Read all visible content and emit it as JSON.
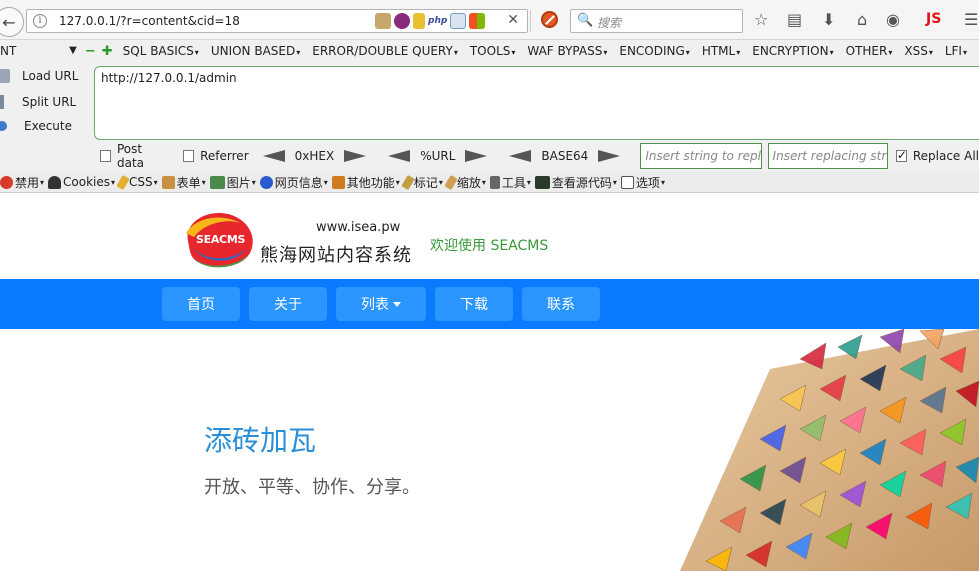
{
  "browser": {
    "url": "127.0.0.1/?r=content&cid=18",
    "search_placeholder": "搜索",
    "js_badge": "JS"
  },
  "hackbar": {
    "select_value": "NT",
    "menu": [
      "SQL BASICS",
      "UNION BASED",
      "ERROR/DOUBLE QUERY",
      "TOOLS",
      "WAF BYPASS",
      "ENCODING",
      "HTML",
      "ENCRYPTION",
      "OTHER",
      "XSS",
      "LFI"
    ],
    "load_url": "Load URL",
    "split_url": "Split URL",
    "execute": "Execute",
    "url_value": "http://127.0.0.1/admin",
    "post_data": "Post data",
    "referrer": "Referrer",
    "hex": "0xHEX",
    "url_enc": "%URL",
    "base64": "BASE64",
    "insert_placeholder": "Insert string to replace",
    "replacing_placeholder": "Insert replacing string",
    "replace_all": "Replace All"
  },
  "addon_bar": {
    "items": [
      "禁用",
      "Cookies",
      "CSS",
      "表单",
      "图片",
      "网页信息",
      "其他功能",
      "标记",
      "缩放",
      "工具",
      "查看源代码",
      "选项"
    ]
  },
  "site": {
    "logo_text": "SEACMS",
    "domain": "www.isea.pw",
    "name": "熊海网站内容系统",
    "welcome": "欢迎使用 SEACMS",
    "nav": [
      "首页",
      "关于",
      "列表",
      "下载",
      "联系"
    ],
    "hero_title": "添砖加瓦",
    "hero_subtitle": "开放、平等、协作、分享。"
  }
}
